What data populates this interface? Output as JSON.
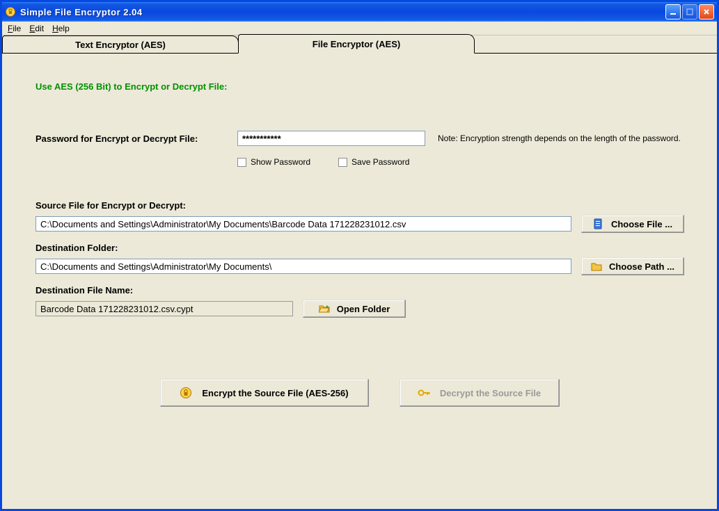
{
  "window": {
    "title": "Simple File Encryptor 2.04"
  },
  "menu": {
    "file": "File",
    "edit": "Edit",
    "help": "Help"
  },
  "tabs": {
    "text": "Text  Encryptor (AES)",
    "file": "File  Encryptor (AES)"
  },
  "heading": "Use AES (256 Bit) to Encrypt or Decrypt File:",
  "password": {
    "label": "Password for Encrypt or Decrypt File:",
    "value": "***********",
    "note": "Note: Encryption strength depends on the length of the password.",
    "show": "Show Password",
    "save": "Save Password"
  },
  "source": {
    "label": "Source File for Encrypt or Decrypt:",
    "value": "C:\\Documents and Settings\\Administrator\\My Documents\\Barcode Data 171228231012.csv",
    "button": "Choose File ..."
  },
  "dest_folder": {
    "label": "Destination Folder:",
    "value": "C:\\Documents and Settings\\Administrator\\My Documents\\",
    "button": "Choose Path ..."
  },
  "dest_file": {
    "label": "Destination File Name:",
    "value": "Barcode Data 171228231012.csv.cypt",
    "open": "Open Folder"
  },
  "actions": {
    "encrypt": "Encrypt the Source File (AES-256)",
    "decrypt": "Decrypt the Source File"
  }
}
